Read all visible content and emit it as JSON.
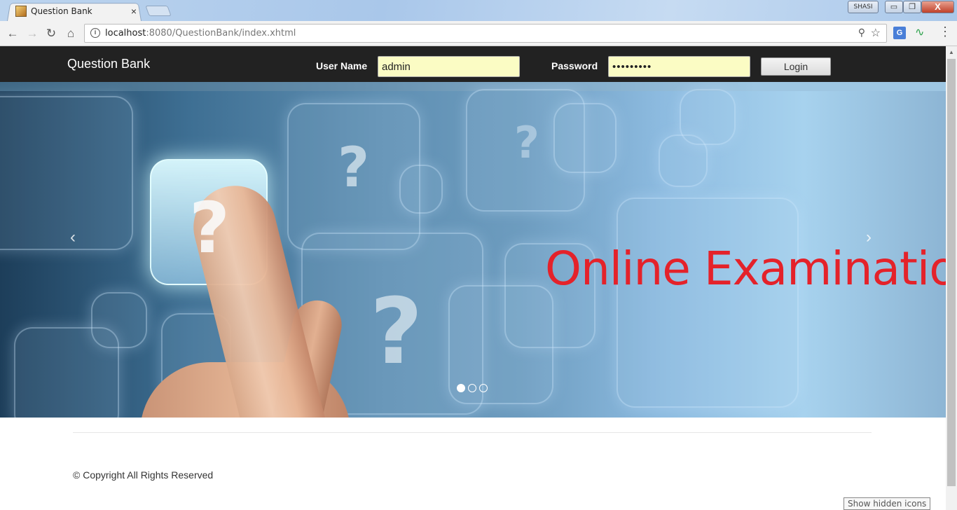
{
  "browser": {
    "tab_title": "Question Bank",
    "tab_close": "×",
    "user_badge": "SHASI",
    "min_glyph": "▭",
    "max_glyph": "❐",
    "close_glyph": "X",
    "back_glyph": "←",
    "forward_glyph": "→",
    "reload_glyph": "↻",
    "home_glyph": "⌂",
    "info_glyph": "i",
    "url_host": "localhost",
    "url_path": ":8080/QuestionBank/index.xhtml",
    "key_glyph": "⚲",
    "star_glyph": "☆",
    "translate_glyph": "G",
    "ext_glyph": "∿",
    "menu_glyph": "⋮"
  },
  "header": {
    "brand": "Question Bank",
    "username_label": "User Name",
    "username_value": "admin",
    "password_label": "Password",
    "password_value": "•••••••••",
    "login_label": "Login"
  },
  "carousel": {
    "headline": "Online Examination",
    "prev_glyph": "‹",
    "next_glyph": "›",
    "slides_total": 3,
    "active_slide": 1,
    "qmark": "?"
  },
  "footer": {
    "copyright": "© Copyright All Rights Reserved"
  },
  "taskbar": {
    "tooltip": "Show hidden icons"
  }
}
